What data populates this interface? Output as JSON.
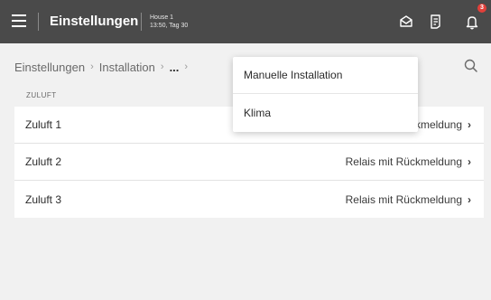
{
  "topbar": {
    "title": "Einstellungen",
    "house_name": "House 1",
    "house_time": "13:50, Tag 30",
    "notification_count": "3"
  },
  "breadcrumb": {
    "items": [
      "Einstellungen",
      "Installation",
      "..."
    ]
  },
  "section": {
    "label": "ZULUFT"
  },
  "list": {
    "rows": [
      {
        "label": "Zuluft 1",
        "value": "Relais mit Rückmeldung"
      },
      {
        "label": "Zuluft 2",
        "value": "Relais mit Rückmeldung"
      },
      {
        "label": "Zuluft 3",
        "value": "Relais mit Rückmeldung"
      }
    ]
  },
  "dropdown": {
    "items": [
      "Manuelle Installation",
      "Klima"
    ]
  },
  "colors": {
    "topbar": "#4a4a4a",
    "background": "#f1f1f1",
    "badge": "#e2403a"
  }
}
